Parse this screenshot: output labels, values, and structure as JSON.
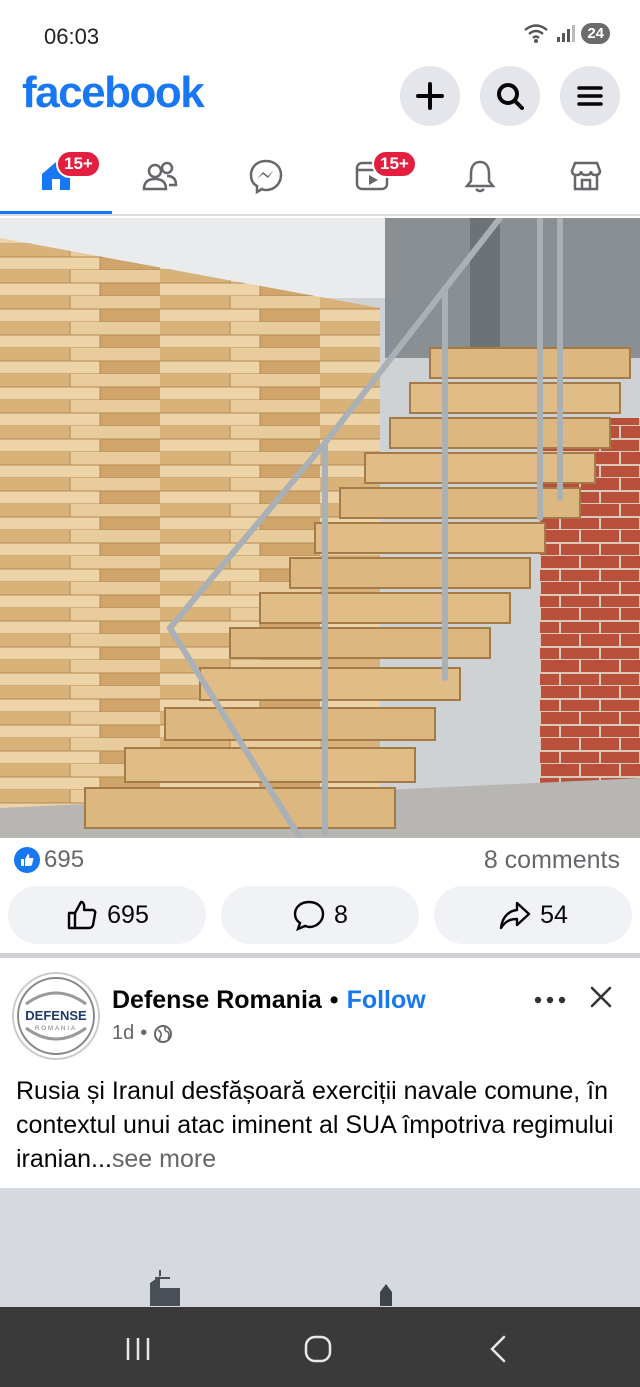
{
  "status_bar": {
    "time": "06:03",
    "battery": "24"
  },
  "header": {
    "logo": "facebook",
    "icons": [
      "plus-icon",
      "search-icon",
      "menu-icon"
    ]
  },
  "tabs": {
    "home_badge": "15+",
    "video_badge": "15+",
    "items": [
      "home",
      "friends",
      "messenger",
      "video",
      "notifications",
      "marketplace"
    ]
  },
  "post1": {
    "likes": "695",
    "comments": "8 comments",
    "actions": {
      "like": "695",
      "comment": "8",
      "share": "54"
    }
  },
  "post2": {
    "avatar_text": "DEFENSE",
    "avatar_subtext": "ROMANIA",
    "author": "Defense Romania",
    "dot": "•",
    "follow": "Follow",
    "time": "1d",
    "meta_dot": "•",
    "text": "Rusia și Iranul desfășoară exerciții navale comune, în contextul unui atac iminent al SUA împotriva regimului iranian...",
    "see_more": "see more"
  },
  "colors": {
    "brand": "#1877f2",
    "badge": "#e41e3f",
    "nav_bg": "#3a3a3a"
  }
}
